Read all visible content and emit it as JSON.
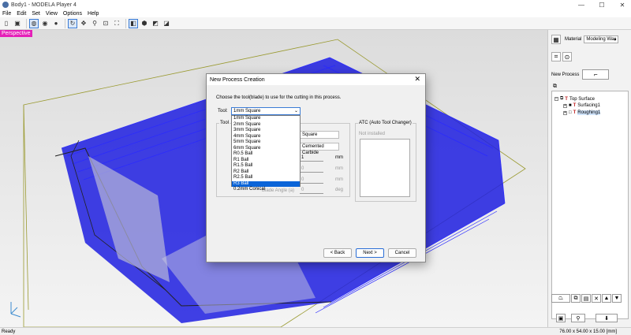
{
  "window": {
    "title": "Body1 - MODELA Player 4",
    "minimize": "—",
    "maximize": "☐",
    "close": "✕"
  },
  "menu": [
    "File",
    "Edit",
    "Set",
    "View",
    "Options",
    "Help"
  ],
  "viewport": {
    "label": "Perspective",
    "axis_labels": {
      "z": "z",
      "x": "x"
    }
  },
  "panel": {
    "material_label": "Material",
    "material_value": "Modeling Wax",
    "new_process_label": "New Process",
    "tree": [
      {
        "label": "Top Surface"
      },
      {
        "label": "Surfacing1"
      },
      {
        "label": "Roughing1"
      }
    ]
  },
  "status": {
    "left": "Ready",
    "dims": "76.00 x 54.00 x 15.00 [mm]"
  },
  "dialog": {
    "title": "New Process Creation",
    "close": "✕",
    "instruction": "Choose the tool(blade) to use for the cutting in this process.",
    "tool_label": "Tool:",
    "tool_selected": "1mm Square",
    "tool_options": [
      "1mm Square",
      "2mm Square",
      "3mm Square",
      "4mm Square",
      "5mm Square",
      "6mm Square",
      "R0.5 Ball",
      "R1 Ball",
      "R1.5 Ball",
      "R2 Ball",
      "R2.5 Ball",
      "R3 Ball",
      "0.2mm Conical"
    ],
    "highlighted_option": "R3 Ball",
    "tool_group_label": "Tool",
    "type_value": "Square",
    "material_value": "Cemented Carbide",
    "diameter_value": "1",
    "unit_mm": "mm",
    "field_zero_1": "0",
    "unit_rpm_1": "mm",
    "field_zero_2": "0",
    "unit_rpm_2": "mm",
    "field_zero_3": "0",
    "unit_deg": "deg",
    "blade_angle_label": "Blade Angle (a)",
    "atc_title": "ATC (Auto Tool Changer)",
    "atc_status": "Not installed",
    "back_label": "< Back",
    "next_label": "Next >",
    "cancel_label": "Cancel"
  }
}
